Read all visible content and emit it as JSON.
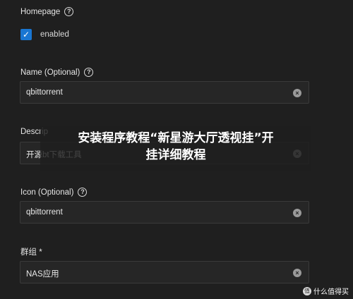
{
  "homepage": {
    "label": "Homepage",
    "checkbox_label": "enabled",
    "checked": true
  },
  "name_field": {
    "label": "Name (Optional)",
    "value": "qbittorrent"
  },
  "description_field": {
    "label_visible": "Descrip",
    "value_visible": "开源bt下载工具"
  },
  "icon_field": {
    "label": "Icon (Optional)",
    "value": "qbittorrent"
  },
  "group_field": {
    "label": "群组 *",
    "value": "NAS应用"
  },
  "overlay_banner": {
    "line1": "安装程序教程“新星游大厅透视挂”开",
    "line2": "挂详细教程"
  },
  "watermark": {
    "text": "什么值得买"
  },
  "icons": {
    "help": "help-circle-icon",
    "clear": "clear-circle-icon",
    "check": "checkmark-icon"
  },
  "colors": {
    "background": "#1f1f1f",
    "field": "#262626",
    "accent": "#1976d2"
  }
}
